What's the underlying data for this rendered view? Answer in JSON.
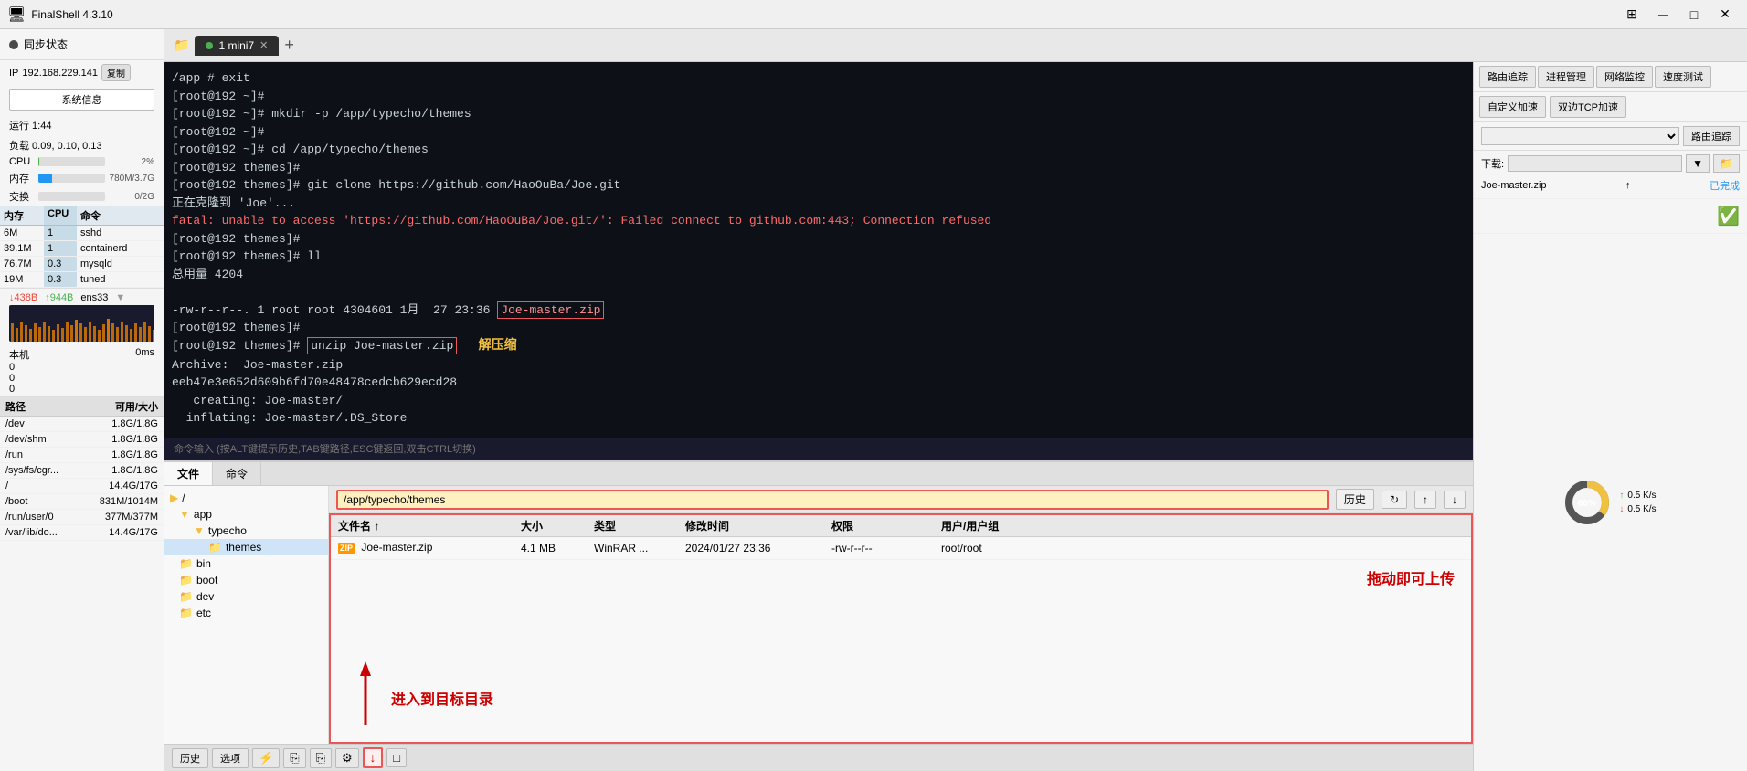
{
  "titlebar": {
    "app_name": "FinalShell 4.3.10",
    "grid_icon": "⊞",
    "min_btn": "─",
    "max_btn": "□",
    "close_btn": "✕"
  },
  "sidebar": {
    "sync_status": "同步状态",
    "ip_label": "IP",
    "ip_address": "192.168.229.141",
    "copy_label": "复制",
    "sysinfo_btn": "系统信息",
    "runtime_label": "运行 1:44",
    "load_label": "负载 0.09, 0.10, 0.13",
    "cpu_label": "CPU",
    "cpu_percent": "2%",
    "cpu_value": "",
    "mem_label": "内存",
    "mem_percent": "21%",
    "mem_value": "780M/3.7G",
    "swap_label": "交换",
    "swap_percent": "0%",
    "swap_value": "0/2G",
    "proc_header": {
      "mem": "内存",
      "cpu": "CPU",
      "cmd": "命令"
    },
    "processes": [
      {
        "mem": "6M",
        "cpu": "1",
        "cmd": "sshd"
      },
      {
        "mem": "39.1M",
        "cpu": "1",
        "cmd": "containerd"
      },
      {
        "mem": "76.7M",
        "cpu": "0.3",
        "cmd": "mysqld"
      },
      {
        "mem": "19M",
        "cpu": "0.3",
        "cmd": "tuned"
      }
    ],
    "net_interface": "ens33",
    "net_up": "↑944B",
    "net_down": "↓438B",
    "latency_label": "本机",
    "latency_val": "0ms",
    "latency_rows": [
      {
        "val": "0"
      },
      {
        "val": "0"
      },
      {
        "val": "0"
      }
    ],
    "disk_header": {
      "path": "路径",
      "avail": "可用/大小"
    },
    "disks": [
      {
        "path": "/dev",
        "avail": "1.8G/1.8G"
      },
      {
        "path": "/dev/shm",
        "avail": "1.8G/1.8G"
      },
      {
        "path": "/run",
        "avail": "1.8G/1.8G"
      },
      {
        "path": "/sys/fs/cgr...",
        "avail": "1.8G/1.8G"
      },
      {
        "path": "/",
        "avail": "14.4G/17G"
      },
      {
        "path": "/boot",
        "avail": "831M/1014M"
      },
      {
        "path": "/run/user/0",
        "avail": "377M/377M"
      },
      {
        "path": "/var/lib/do...",
        "avail": "14.4G/17G"
      }
    ]
  },
  "tabs": {
    "tab1_label": "1 mini7",
    "add_btn": "+"
  },
  "terminal": {
    "lines": [
      "/app # exit",
      "[root@192 ~]#",
      "[root@192 ~]# mkdir -p /app/typecho/themes",
      "[root@192 ~]#",
      "[root@192 ~]# cd /app/typecho/themes",
      "[root@192 themes]#",
      "[root@192 themes]# git clone https://github.com/HaoOuBa/Joe.git",
      "正在克隆到 'Joe'...",
      "fatal: unable to access 'https://github.com/HaoOuBa/Joe.git/': Failed connect to github.com:443; Connection refused",
      "[root@192 themes]#",
      "[root@192 themes]# ll",
      "总用量 4204",
      "",
      "-rw-r--r--. 1 root root 4304601 1月  27 23:36 Joe-master.zip",
      "[root@192 themes]#",
      "[root@192 themes]# unzip Joe-master.zip",
      "Archive:  Joe-master.zip",
      "eeb47e3e652d609b6fd70e48478cedcb629ecd28",
      "   creating: Joe-master/",
      "  inflating: Joe-master/.DS_Store"
    ],
    "highlight_filename": "Joe-master.zip",
    "highlight_cmd": "unzip Joe-master.zip",
    "annotation_unzip": "解压缩",
    "cmd_placeholder": "命令输入 (按ALT键提示历史,TAB键路径,ESC键返回,双击CTRL切换)"
  },
  "bottom_toolbar": {
    "history_btn": "历史",
    "options_btn": "选项",
    "icons": [
      "⚡",
      "⎘",
      "⎘",
      "⚙",
      "↓",
      "□"
    ]
  },
  "file_manager": {
    "tab_files": "文件",
    "tab_commands": "命令",
    "path_value": "/app/typecho/themes",
    "history_btn": "历史",
    "tree": {
      "root": "/",
      "items": [
        {
          "label": "app",
          "indent": 1,
          "type": "folder"
        },
        {
          "label": "typecho",
          "indent": 2,
          "type": "folder"
        },
        {
          "label": "themes",
          "indent": 3,
          "type": "folder",
          "selected": true
        },
        {
          "label": "bin",
          "indent": 1,
          "type": "folder"
        },
        {
          "label": "boot",
          "indent": 1,
          "type": "folder"
        },
        {
          "label": "dev",
          "indent": 1,
          "type": "folder"
        },
        {
          "label": "etc",
          "indent": 1,
          "type": "folder"
        }
      ]
    },
    "file_list_header": {
      "name": "文件名 ↑",
      "size": "大小",
      "type": "类型",
      "mtime": "修改时间",
      "perm": "权限",
      "owner": "用户/用户组"
    },
    "files": [
      {
        "name": "Joe-master.zip",
        "size": "4.1 MB",
        "type": "WinRAR ...",
        "mtime": "2024/01/27 23:36",
        "perm": "-rw-r--r--",
        "owner": "root/root",
        "icon": "zip"
      }
    ],
    "annotation_enter": "进入到目标目录",
    "annotation_upload": "拖动即可上传"
  },
  "right_panel": {
    "route_trace_btn": "路由追踪",
    "toolbar_btns": [
      "路由追踪",
      "进程管理",
      "网络监控",
      "速度测试"
    ],
    "toolbar_btns2": [
      "自定义加速",
      "双边TCP加速"
    ],
    "route_dropdown_placeholder": "",
    "route_btn": "路由追踪",
    "download_label": "下载:",
    "download_url": "",
    "file_name": "Joe-master.zip",
    "complete_label": "已完成",
    "circle_percent": "60%",
    "speed_up": "0.5 K/s",
    "speed_down": "0.5 K/s"
  }
}
